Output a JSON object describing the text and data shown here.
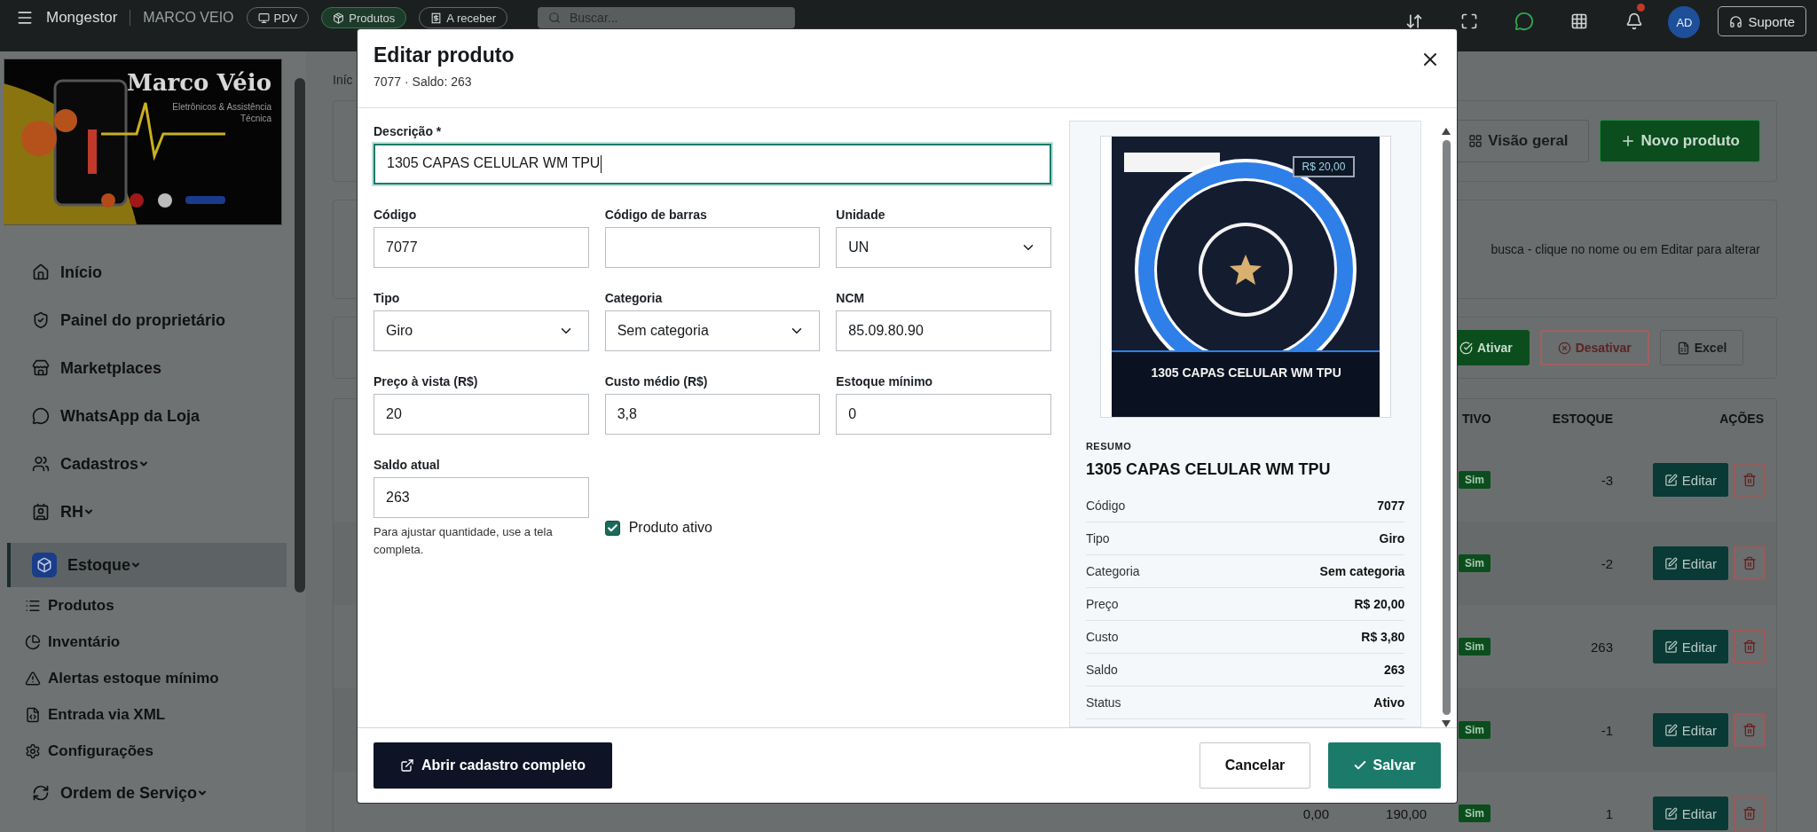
{
  "topbar": {
    "brand": "Mongestor",
    "store": "MARCO VEIO",
    "quick_links": [
      {
        "label": "PDV",
        "selected": false
      },
      {
        "label": "Produtos",
        "selected": true
      },
      {
        "label": "A receber",
        "selected": false
      }
    ],
    "search": {
      "placeholder": "Buscar..."
    },
    "notification_dot": true,
    "avatar": "AD",
    "support": "Suporte"
  },
  "sidebar": {
    "banner": {
      "title": "Marco Véio",
      "subtitle": "Eletrônicos & Assistência Técnica"
    },
    "items": [
      {
        "label": "Início",
        "selected": false,
        "dropdown": false
      },
      {
        "label": "Painel do proprietário",
        "selected": false,
        "dropdown": false
      },
      {
        "label": "Marketplaces",
        "selected": false,
        "dropdown": false
      },
      {
        "label": "WhatsApp da Loja",
        "selected": false,
        "dropdown": false
      },
      {
        "label": "Cadastros",
        "selected": false,
        "dropdown": true
      },
      {
        "label": "RH",
        "selected": false,
        "dropdown": true
      },
      {
        "label": "Estoque",
        "selected": true,
        "dropdown": true,
        "children": [
          {
            "label": "Produtos"
          },
          {
            "label": "Inventário"
          },
          {
            "label": "Alertas estoque mínimo"
          },
          {
            "label": "Entrada via XML"
          },
          {
            "label": "Configurações"
          }
        ]
      },
      {
        "label": "Ordem de Serviço",
        "selected": false,
        "dropdown": true
      }
    ]
  },
  "page": {
    "breadcrumb": "Iníc",
    "header_buttons": [
      {
        "label": "Visão geral",
        "kind": "secondary"
      },
      {
        "label": "Novo produto",
        "kind": "primary"
      }
    ],
    "search_hint": "busca - clique no nome ou em Editar para alterar",
    "bulk_actions": [
      {
        "label": "Ativar",
        "kind": "primary"
      },
      {
        "label": "Desativar",
        "kind": "danger"
      },
      {
        "label": "Excel",
        "kind": "secondary"
      }
    ],
    "table": {
      "columns": [
        "TIVO",
        "ESTOQUE",
        "AÇÕES"
      ],
      "rows": [
        {
          "active": "Sim",
          "stock": "-3",
          "edit": "Editar"
        },
        {
          "active": "Sim",
          "stock": "-2",
          "edit": "Editar"
        },
        {
          "active": "Sim",
          "stock": "263",
          "edit": "Editar"
        },
        {
          "active": "Sim",
          "stock": "-1",
          "edit": "Editar"
        },
        {
          "column_5": "0,00",
          "column_6": "190,00",
          "active": "Sim",
          "stock": "1",
          "edit": "Editar"
        }
      ]
    }
  },
  "modal": {
    "title": "Editar produto",
    "subtitle": "7077 · Saldo: 263",
    "description": {
      "label": "Descrição *",
      "value": "1305 CAPAS CELULAR WM TPU",
      "focused": true
    },
    "fields": [
      {
        "label": "Código",
        "kind": "text",
        "value": "7077"
      },
      {
        "label": "Código de barras",
        "kind": "text"
      },
      {
        "label": "Unidade",
        "kind": "select",
        "value": "UN"
      },
      {
        "label": "Tipo",
        "kind": "select",
        "value": "Giro"
      },
      {
        "label": "Categoria",
        "kind": "select",
        "value": "Sem categoria"
      },
      {
        "label": "NCM",
        "kind": "text",
        "value": "85.09.80.90"
      },
      {
        "label": "Preço à vista (R$)",
        "kind": "text",
        "value": "20"
      },
      {
        "label": "Custo médio (R$)",
        "kind": "text",
        "value": "3,8"
      },
      {
        "label": "Estoque mínimo",
        "kind": "text",
        "value": "0"
      }
    ],
    "balance": {
      "label": "Saldo atual",
      "value": "263",
      "help": "Para ajustar quantidade, use a tela completa."
    },
    "active_checkbox": {
      "label": "Produto ativo",
      "checked": true
    },
    "summary": {
      "image": {
        "price": "R$ 20,00",
        "title": "1305 CAPAS CELULAR WM TPU"
      },
      "heading": "RESUMO",
      "name": "1305 CAPAS CELULAR WM TPU",
      "rows": [
        {
          "label": "Código",
          "value": "7077"
        },
        {
          "label": "Tipo",
          "value": "Giro"
        },
        {
          "label": "Categoria",
          "value": "Sem categoria"
        },
        {
          "label": "Preço",
          "value": "R$ 20,00"
        },
        {
          "label": "Custo",
          "value": "R$ 3,80"
        },
        {
          "label": "Saldo",
          "value": "263"
        },
        {
          "label": "Status",
          "value": "Ativo"
        }
      ]
    },
    "footer": {
      "open_full": "Abrir cadastro completo",
      "cancel": "Cancelar",
      "save": "Salvar"
    }
  }
}
